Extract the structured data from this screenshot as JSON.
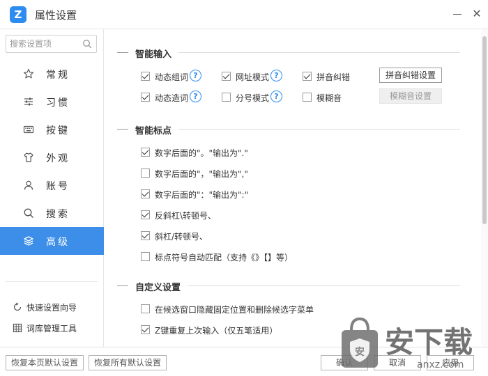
{
  "window": {
    "title": "属性设置",
    "logo_glyph": "Z",
    "close_glyph": "✕"
  },
  "sidebar": {
    "search_placeholder": "搜索设置项",
    "items": [
      {
        "label": "常规",
        "icon": "star-icon"
      },
      {
        "label": "习惯",
        "icon": "sliders-icon"
      },
      {
        "label": "按键",
        "icon": "keyboard-icon"
      },
      {
        "label": "外观",
        "icon": "tshirt-icon"
      },
      {
        "label": "账号",
        "icon": "user-icon"
      },
      {
        "label": "搜索",
        "icon": "search-icon"
      },
      {
        "label": "高级",
        "icon": "layers-icon",
        "active": true
      }
    ],
    "tools": [
      {
        "label": "快速设置向导",
        "icon": "refresh-icon"
      },
      {
        "label": "词库管理工具",
        "icon": "grid-icon"
      }
    ]
  },
  "sections": {
    "smart_input": {
      "title": "智能输入",
      "options": {
        "dynamic_group": {
          "label": "动态组词",
          "checked": true
        },
        "url_mode": {
          "label": "网址模式",
          "checked": true
        },
        "pinyin_correct": {
          "label": "拼音纠错",
          "checked": true
        },
        "dynamic_create": {
          "label": "动态造词",
          "checked": true
        },
        "semicolon_mode": {
          "label": "分号模式",
          "checked": false
        },
        "fuzzy_sound": {
          "label": "模糊音",
          "checked": false
        }
      },
      "help_glyph": "?",
      "pinyin_correct_settings_button": "拼音纠错设置",
      "fuzzy_settings_button": "模糊音设置"
    },
    "smart_punct": {
      "title": "智能标点",
      "options": [
        {
          "label": "数字后面的\"。\"输出为\".\"",
          "checked": true
        },
        {
          "label": "数字后面的\"，\"输出为\",\"",
          "checked": false
        },
        {
          "label": "数字后面的\"：\"输出为\":\"",
          "checked": true
        },
        {
          "label": "反斜杠\\转顿号、",
          "checked": true
        },
        {
          "label": "斜杠/转顿号、",
          "checked": true
        },
        {
          "label": "标点符号自动匹配（支持《》【】等）",
          "checked": false
        }
      ]
    },
    "custom": {
      "title": "自定义设置",
      "options": [
        {
          "label": "在候选窗口隐藏固定位置和删除候选字菜单",
          "checked": false
        },
        {
          "label": "Z键重复上次输入（仅五笔适用）",
          "checked": true
        }
      ]
    }
  },
  "footer": {
    "restore_page": "恢复本页默认设置",
    "restore_all": "恢复所有默认设置",
    "ok": "确认",
    "cancel": "取消",
    "apply": "应用"
  },
  "watermark": {
    "big": "安下载",
    "small": "anxz.com"
  },
  "colors": {
    "accent": "#3d8ee8",
    "help": "#2d8cf0"
  }
}
